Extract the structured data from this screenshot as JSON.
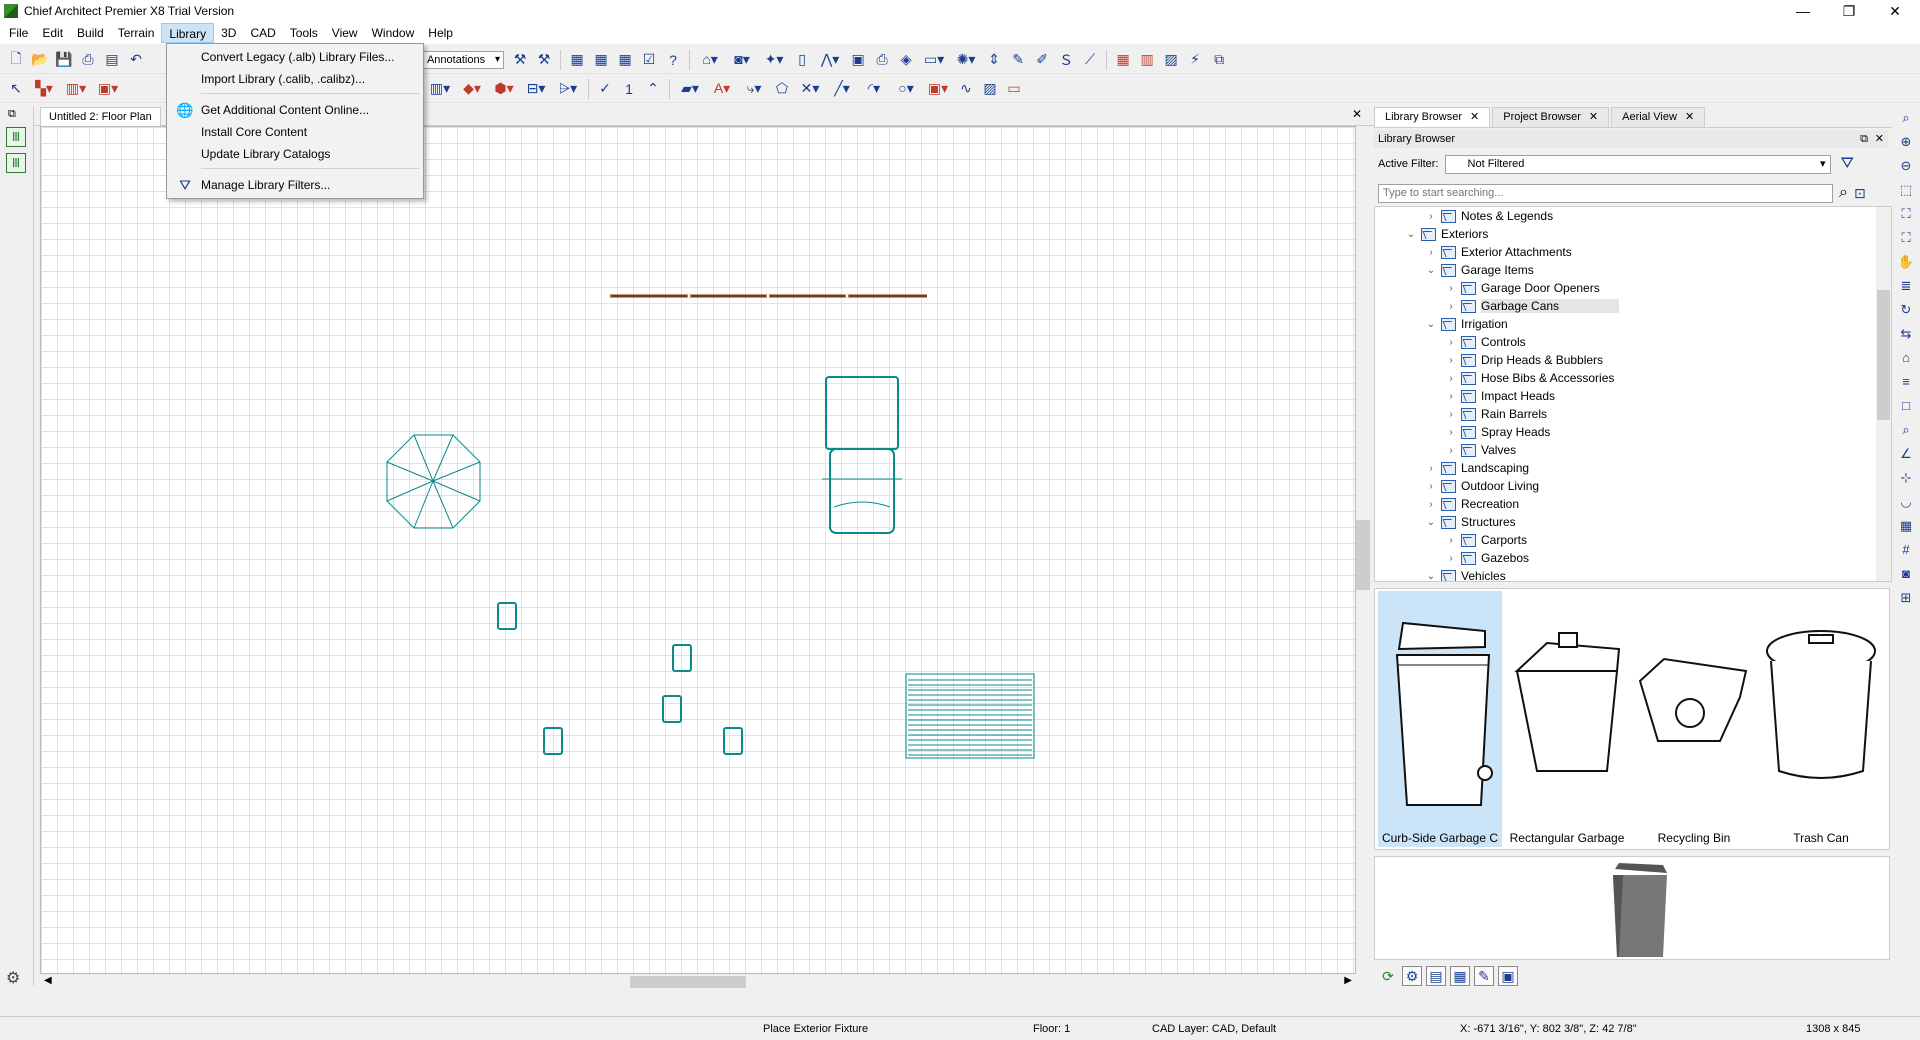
{
  "window": {
    "title": "Chief Architect Premier X8 Trial Version",
    "controls": {
      "minimize": "—",
      "restore": "❐",
      "close": "✕"
    }
  },
  "menubar": [
    "File",
    "Edit",
    "Build",
    "Terrain",
    "Library",
    "3D",
    "CAD",
    "Tools",
    "View",
    "Window",
    "Help"
  ],
  "library_menu": {
    "items": [
      {
        "label": "Convert Legacy (.alb) Library Files...",
        "icon": ""
      },
      {
        "label": "Import Library (.calib, .calibz)...",
        "icon": ""
      },
      {
        "label": "Get Additional Content Online...",
        "icon": "globe-icon"
      },
      {
        "label": "Install Core Content",
        "icon": ""
      },
      {
        "label": "Update Library Catalogs",
        "icon": ""
      },
      {
        "label": "Manage Library Filters...",
        "icon": "filter-icon"
      }
    ]
  },
  "toolbar": {
    "annotation_combo": "Scale Annotations",
    "number_field": "1"
  },
  "plan": {
    "tab_title": "Untitled 2: Floor Plan"
  },
  "library": {
    "tabs": [
      "Library Browser",
      "Project Browser",
      "Aerial View"
    ],
    "panel_title": "Library Browser",
    "filter_label": "Active Filter:",
    "filter_value": "Not Filtered",
    "search_placeholder": "Type to start searching...",
    "tree": [
      {
        "label": "Notes & Legends",
        "level": 1,
        "expanded": false
      },
      {
        "label": "Exteriors",
        "level": 0,
        "expanded": true
      },
      {
        "label": "Exterior Attachments",
        "level": 1,
        "expanded": false
      },
      {
        "label": "Garage Items",
        "level": 1,
        "expanded": true
      },
      {
        "label": "Garage Door Openers",
        "level": 2,
        "expanded": false
      },
      {
        "label": "Garbage Cans",
        "level": 2,
        "expanded": false,
        "selected": true
      },
      {
        "label": "Irrigation",
        "level": 1,
        "expanded": true
      },
      {
        "label": "Controls",
        "level": 2,
        "expanded": false
      },
      {
        "label": "Drip Heads & Bubblers",
        "level": 2,
        "expanded": false
      },
      {
        "label": "Hose Bibs & Accessories",
        "level": 2,
        "expanded": false
      },
      {
        "label": "Impact Heads",
        "level": 2,
        "expanded": false
      },
      {
        "label": "Rain Barrels",
        "level": 2,
        "expanded": false
      },
      {
        "label": "Spray Heads",
        "level": 2,
        "expanded": false
      },
      {
        "label": "Valves",
        "level": 2,
        "expanded": false
      },
      {
        "label": "Landscaping",
        "level": 1,
        "expanded": false
      },
      {
        "label": "Outdoor Living",
        "level": 1,
        "expanded": false
      },
      {
        "label": "Recreation",
        "level": 1,
        "expanded": false
      },
      {
        "label": "Structures",
        "level": 1,
        "expanded": true
      },
      {
        "label": "Carports",
        "level": 2,
        "expanded": false
      },
      {
        "label": "Gazebos",
        "level": 2,
        "expanded": false
      },
      {
        "label": "Vehicles",
        "level": 1,
        "expanded": true
      }
    ],
    "thumbnails": [
      "Curb-Side Garbage C",
      "Rectangular Garbage",
      "Recycling Bin",
      "Trash Can"
    ]
  },
  "status": {
    "action": "Place Exterior Fixture",
    "floor": "Floor: 1",
    "layer": "CAD Layer: CAD,  Default",
    "coords": "X: -671 3/16\", Y: 802 3/8\", Z: 42 7/8\"",
    "size": "1308 x 845"
  },
  "colors": {
    "plan_objects": "#0a8a8a",
    "fence": "#7a3b10",
    "selection": "#cce4f7"
  }
}
